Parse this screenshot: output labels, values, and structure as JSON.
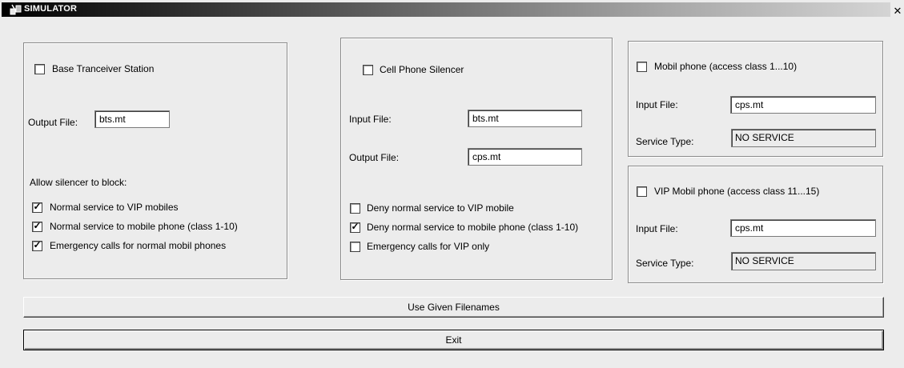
{
  "window": {
    "title": "SIMULATOR",
    "close_symbol": "✕"
  },
  "bts": {
    "checkbox_label": "Base Tranceiver Station",
    "checked": false,
    "output_label": "Output File:",
    "output_value": "bts.mt",
    "allow_label": "Allow silencer to block:",
    "options": [
      {
        "label": "Normal service to VIP mobiles",
        "checked": true
      },
      {
        "label": "Normal service to mobile phone (class 1-10)",
        "checked": true
      },
      {
        "label": "Emergency calls for normal mobil phones",
        "checked": true
      }
    ]
  },
  "cps": {
    "checkbox_label": "Cell Phone Silencer",
    "checked": false,
    "input_label": "Input File:",
    "input_value": "bts.mt",
    "output_label": "Output File:",
    "output_value": "cps.mt",
    "options": [
      {
        "label": "Deny normal service to VIP mobile",
        "checked": false
      },
      {
        "label": "Deny normal service to mobile phone (class 1-10)",
        "checked": true
      },
      {
        "label": "Emergency calls for VIP only",
        "checked": false
      }
    ]
  },
  "mobil": {
    "checkbox_label": "Mobil phone (access class 1...10)",
    "checked": false,
    "input_label": "Input File:",
    "input_value": "cps.mt",
    "service_label": "Service Type:",
    "service_value": "NO SERVICE"
  },
  "vip": {
    "checkbox_label": "VIP Mobil phone (access class 11...15)",
    "checked": false,
    "input_label": "Input File:",
    "input_value": "cps.mt",
    "service_label": "Service Type:",
    "service_value": "NO SERVICE"
  },
  "buttons": {
    "use_given": "Use Given Filenames",
    "exit": "Exit"
  },
  "check_mark": "✓"
}
